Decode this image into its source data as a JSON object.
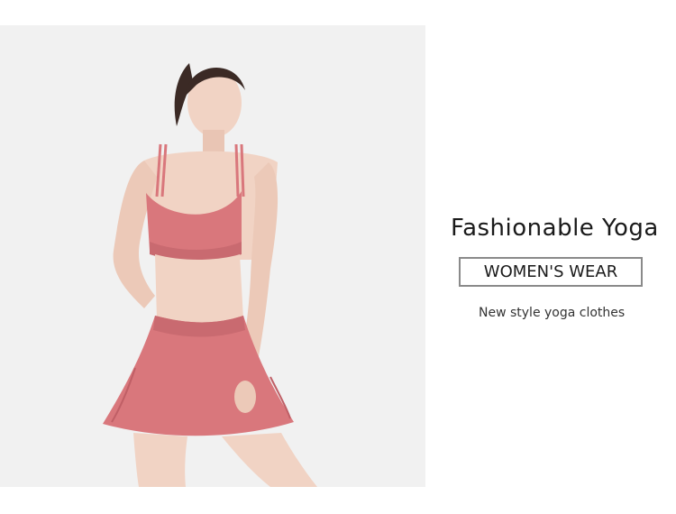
{
  "product_photo": {
    "alt": "model-in-pink-yoga-set",
    "colors": {
      "background": "#f1f1f1",
      "garment": "#d9777c",
      "garment_shadow": "#c05f66",
      "skin": "#f1d3c4",
      "skin_shadow": "#e2b6a4",
      "hair": "#3b2a25"
    }
  },
  "headline": "Fashionable Yoga",
  "badge": "WOMEN'S WEAR",
  "subline": "New style yoga clothes"
}
